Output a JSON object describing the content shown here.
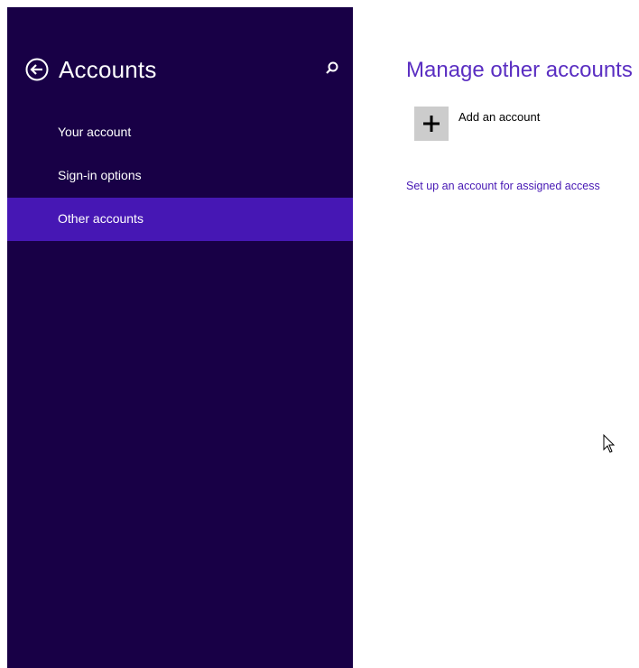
{
  "sidebar": {
    "title": "Accounts",
    "back_icon": "back-arrow-icon",
    "search_icon": "search-icon",
    "items": [
      {
        "label": "Your account",
        "selected": false
      },
      {
        "label": "Sign-in options",
        "selected": false
      },
      {
        "label": "Other accounts",
        "selected": true
      }
    ]
  },
  "main": {
    "title": "Manage other accounts",
    "add_account_label": "Add an account",
    "add_icon": "plus-icon",
    "assigned_access_link": "Set up an account for assigned access"
  },
  "colors": {
    "sidebar_bg": "#180046",
    "selected_item_bg": "#4617b4",
    "heading_color": "#5a2ec2",
    "link_color": "#4617b4",
    "tile_bg": "#cccccc"
  },
  "cursor_icon": "mouse-pointer-icon"
}
